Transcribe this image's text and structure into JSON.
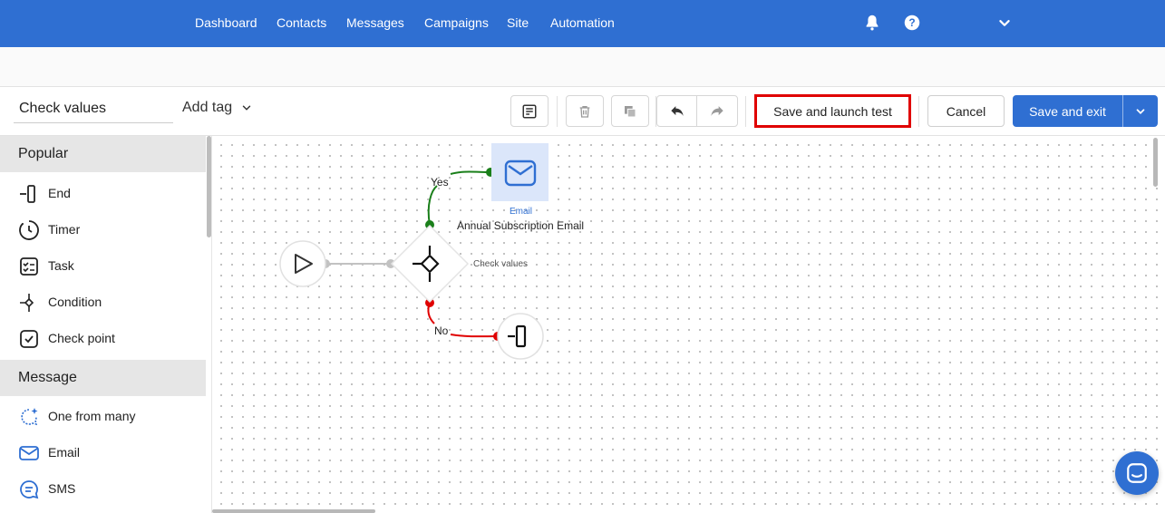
{
  "nav": {
    "items": [
      "Dashboard",
      "Contacts",
      "Messages",
      "Campaigns",
      "Site",
      "Automation"
    ],
    "icons": [
      "bell-icon",
      "help-icon",
      "chevron-down-icon"
    ],
    "color": "#2f6fd2"
  },
  "toolbar": {
    "automation_name": "Check values",
    "add_tag_label": "Add tag",
    "launch_label": "Save and launch test",
    "cancel_label": "Cancel",
    "save_exit_label": "Save and exit",
    "icons": [
      "notes-icon",
      "trash-icon",
      "copy-icon",
      "undo-icon",
      "redo-icon"
    ]
  },
  "sidebar": {
    "sections": [
      {
        "title": "Popular",
        "items": [
          {
            "label": "End",
            "icon": "end-icon"
          },
          {
            "label": "Timer",
            "icon": "timer-icon"
          },
          {
            "label": "Task",
            "icon": "task-icon"
          },
          {
            "label": "Condition",
            "icon": "condition-icon"
          },
          {
            "label": "Check point",
            "icon": "checkpoint-icon"
          }
        ]
      },
      {
        "title": "Message",
        "items": [
          {
            "label": "One from many",
            "icon": "sparkle-chat-icon"
          },
          {
            "label": "Email",
            "icon": "email-icon"
          },
          {
            "label": "SMS",
            "icon": "sms-icon"
          }
        ]
      }
    ]
  },
  "canvas": {
    "yes_label": "Yes",
    "no_label": "No",
    "condition_label": "Check values",
    "email_node": {
      "type_label": "Email",
      "title": "Annual Subscription Email"
    },
    "colors": {
      "yes": "#1a7f1a",
      "no": "#e00000",
      "accent": "#2f6fd2"
    }
  }
}
